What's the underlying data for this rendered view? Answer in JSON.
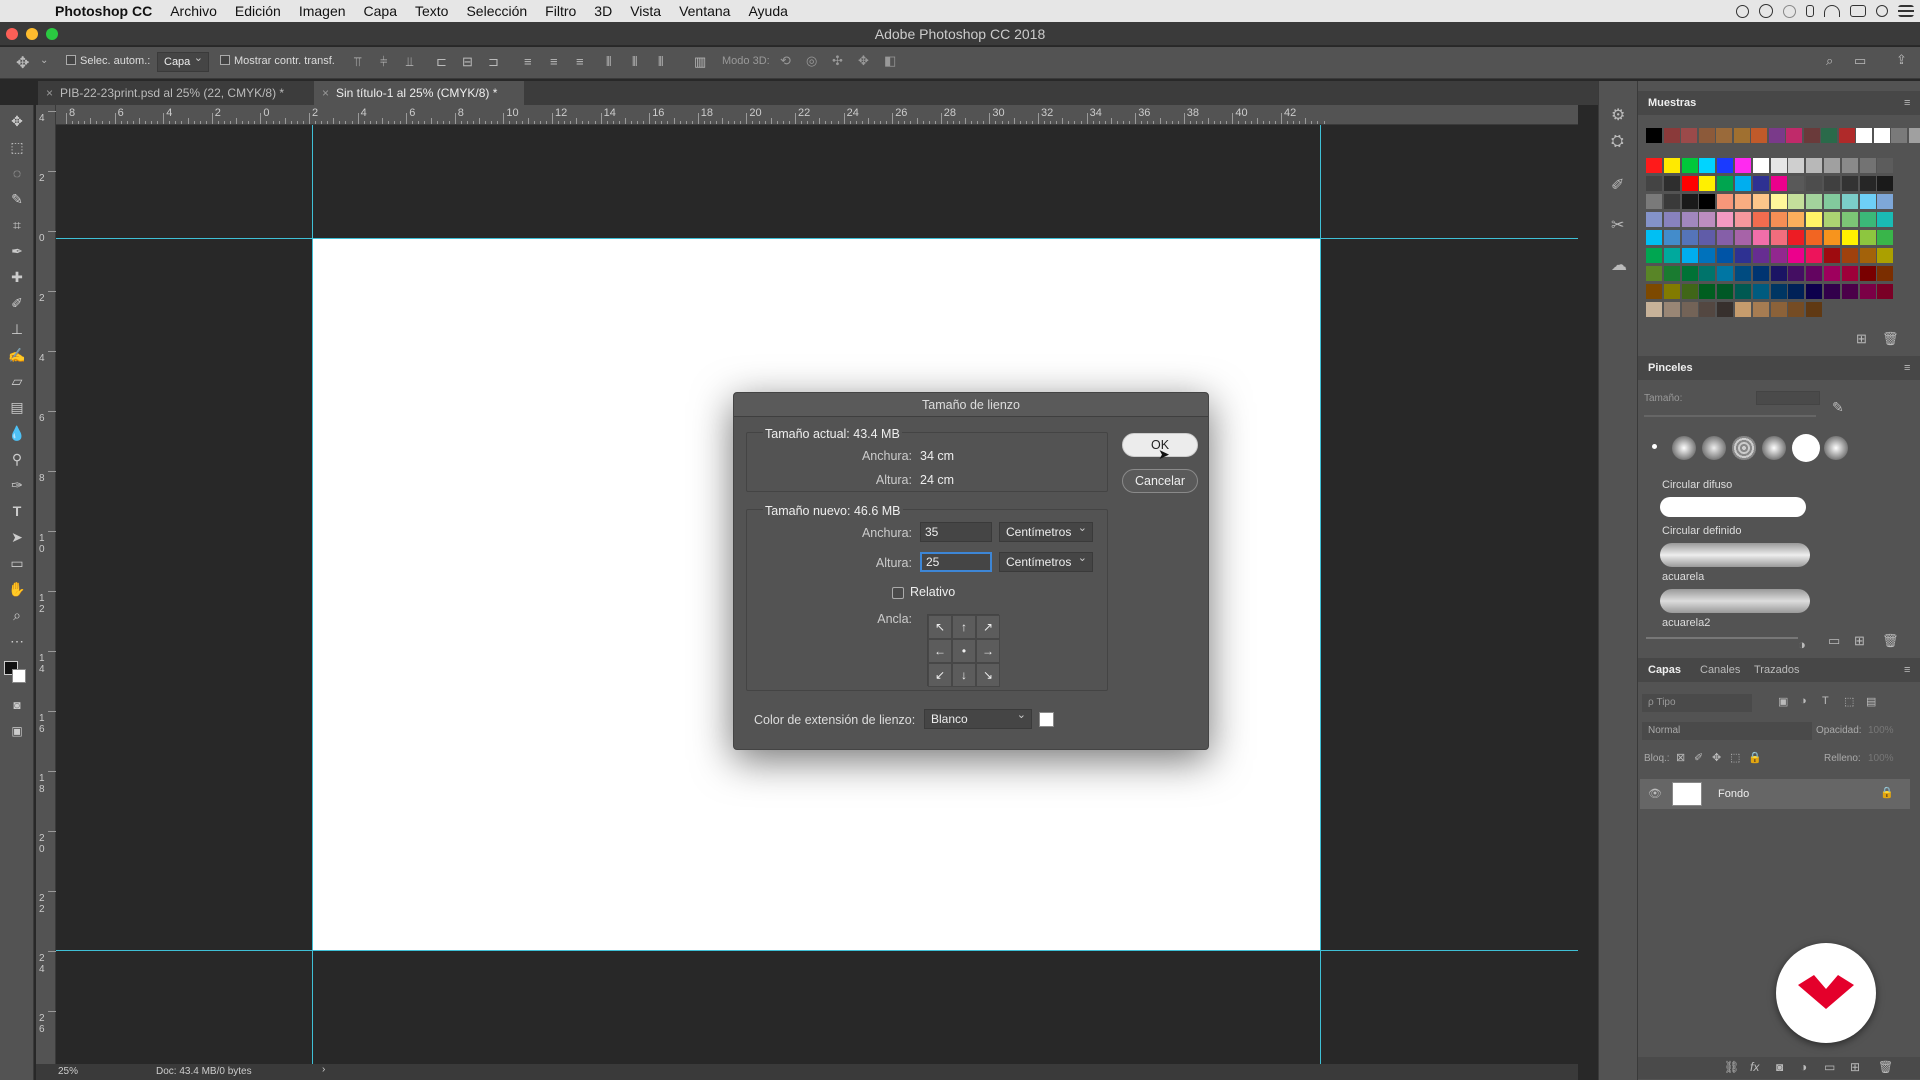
{
  "menubar": {
    "app": "Photoshop CC",
    "items": [
      "Archivo",
      "Edición",
      "Imagen",
      "Capa",
      "Texto",
      "Selección",
      "Filtro",
      "3D",
      "Vista",
      "Ventana",
      "Ayuda"
    ]
  },
  "window": {
    "title": "Adobe Photoshop CC 2018"
  },
  "options": {
    "auto_select": "Selec. autom.:",
    "auto_select_target": "Capa",
    "show_transform": "Mostrar contr. transf.",
    "mode_3d": "Modo 3D:"
  },
  "tabs": [
    {
      "label": "PIB-22-23print.psd al 25% (22, CMYK/8) *",
      "close": "×"
    },
    {
      "label": "Sin título-1 al 25% (CMYK/8) *",
      "close": "×"
    }
  ],
  "ruler": {
    "h_labels": [
      "8",
      "6",
      "4",
      "2",
      "0",
      "2",
      "4",
      "6",
      "8",
      "10",
      "12",
      "14",
      "16",
      "18",
      "20",
      "22",
      "24",
      "26",
      "28",
      "30",
      "32",
      "34",
      "36",
      "38",
      "40",
      "42"
    ],
    "v_labels": [
      "4",
      "2",
      "0",
      "2",
      "4",
      "6",
      "8",
      "1 0",
      "1 2",
      "1 4",
      "1 6",
      "1 8",
      "2 0",
      "2 2",
      "2 4",
      "2 6"
    ]
  },
  "status": {
    "zoom": "25%",
    "doc": "Doc: 43.4 MB/0 bytes",
    "arrow": "›"
  },
  "dialog": {
    "title": "Tamaño de lienzo",
    "current_legend": "Tamaño actual: 43.4 MB",
    "current_width_label": "Anchura:",
    "current_width": "34 cm",
    "current_height_label": "Altura:",
    "current_height": "24 cm",
    "new_legend": "Tamaño nuevo: 46.6 MB",
    "new_width_label": "Anchura:",
    "new_width": "35",
    "new_width_unit": "Centímetros",
    "new_height_label": "Altura:",
    "new_height": "25",
    "new_height_unit": "Centímetros",
    "relative": "Relativo",
    "anchor_label": "Ancla:",
    "anchor": [
      "↖",
      "↑",
      "↗",
      "←",
      "•",
      "→",
      "↙",
      "↓",
      "↘"
    ],
    "ext_color_label": "Color de extensión de lienzo:",
    "ext_color": "Blanco",
    "ok": "OK",
    "cancel": "Cancelar"
  },
  "panels": {
    "swatches": {
      "title": "Muestras"
    },
    "brushes": {
      "title": "Pinceles",
      "size_label": "Tamaño:",
      "presets": [
        {
          "name": "Circular difuso"
        },
        {
          "name": "Circular definido"
        },
        {
          "name": "acuarela"
        },
        {
          "name": "acuarela2"
        }
      ]
    },
    "layers": {
      "tabs": [
        "Capas",
        "Canales",
        "Trazados"
      ],
      "search": "ρ Tipo",
      "blend": "Normal",
      "opacity_label": "Opacidad:",
      "opacity": "100%",
      "lock_label": "Bloq.:",
      "fill_label": "Relleno:",
      "fill": "100%",
      "layer_name": "Fondo"
    }
  },
  "colors": {
    "guide": "#3fc0d6",
    "logo_red": "#e4002b"
  }
}
